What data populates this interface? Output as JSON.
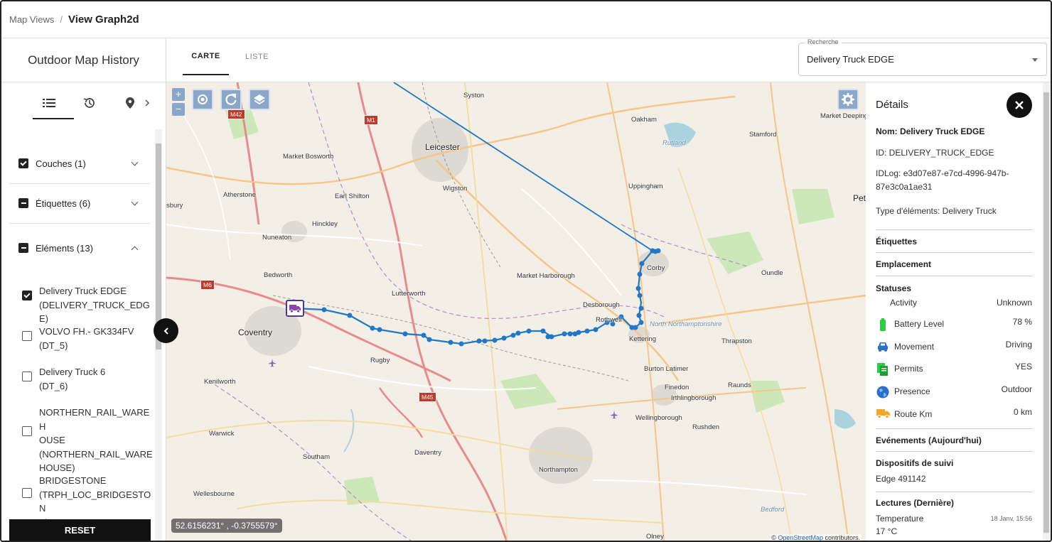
{
  "breadcrumb": {
    "parent": "Map Views",
    "separator": "/",
    "current": "View Graph2d"
  },
  "left_header": {
    "title": "Outdoor Map History"
  },
  "tabs": [
    {
      "label": "CARTE",
      "active": true
    },
    {
      "label": "LISTE",
      "active": false
    }
  ],
  "search": {
    "legend": "Recherche",
    "value": "Delivery Truck EDGE"
  },
  "sidebar": {
    "icons": [
      "list-icon",
      "history-icon",
      "location-pin-icon",
      "chevron-right-icon"
    ],
    "groups": [
      {
        "label": "Couches (1)",
        "state": "checked",
        "expanded": false
      },
      {
        "label": "Étiquettes (6)",
        "state": "partial",
        "expanded": false
      },
      {
        "label": "Eléments (13)",
        "state": "partial",
        "expanded": true
      }
    ],
    "elements": [
      {
        "lines": [
          "Delivery Truck EDGE",
          "(DELIVERY_TRUCK_EDGE)"
        ],
        "checked": true
      },
      {
        "lines": [
          "VOLVO FH.- GK334FV",
          "(DT_5)"
        ],
        "checked": false
      },
      {
        "lines": [
          "Delivery Truck 6",
          "(DT_6)"
        ],
        "checked": false
      },
      {
        "lines": [
          "NORTHERN_RAIL_WAREH",
          "OUSE",
          "(NORTHERN_RAIL_WARE",
          "HOUSE)"
        ],
        "checked": false
      },
      {
        "lines": [
          "BRIDGESTONE",
          "(TRPH_LOC_BRIDGESTON",
          "E)"
        ],
        "checked": false
      }
    ],
    "reset_label": "RESET"
  },
  "map": {
    "coordinates": "52.6156231° , -0.3755579°",
    "attribution_prefix": "© ",
    "attribution_link": "OpenStreetMap",
    "attribution_suffix": " contributors.",
    "zoom_in": "+",
    "zoom_out": "−",
    "places": [
      {
        "name": "Syston"
      },
      {
        "name": "Oakham"
      },
      {
        "name": "Leicester"
      },
      {
        "name": "Market Bosworth"
      },
      {
        "name": "Stamford"
      },
      {
        "name": "Rutland"
      },
      {
        "name": "Market Deeping"
      },
      {
        "name": "Earl Shilton"
      },
      {
        "name": "Wigston"
      },
      {
        "name": "Uppingham"
      },
      {
        "name": "Atherstone"
      },
      {
        "name": "Hinckley"
      },
      {
        "name": "Nuneaton"
      },
      {
        "name": "Corby"
      },
      {
        "name": "Bedworth"
      },
      {
        "name": "Market Harborough"
      },
      {
        "name": "Oundle"
      },
      {
        "name": "Lutterworth"
      },
      {
        "name": "Desborough"
      },
      {
        "name": "Rothwell"
      },
      {
        "name": "Coventry"
      },
      {
        "name": "North Northamptonshire"
      },
      {
        "name": "Kettering"
      },
      {
        "name": "Thrapston"
      },
      {
        "name": "Rugby"
      },
      {
        "name": "Kenilworth"
      },
      {
        "name": "Burton Latimer"
      },
      {
        "name": "Finedon"
      },
      {
        "name": "Raunds"
      },
      {
        "name": "Irthlingborough"
      },
      {
        "name": "Wellingborough"
      },
      {
        "name": "Rushden"
      },
      {
        "name": "Warwick"
      },
      {
        "name": "Southam"
      },
      {
        "name": "Daventry"
      },
      {
        "name": "Northampton"
      },
      {
        "name": "Wellesbourne"
      },
      {
        "name": "Bedford"
      },
      {
        "name": "Olney"
      },
      {
        "name": "sbury"
      },
      {
        "name": "Pet"
      }
    ],
    "road_shields": [
      "M42",
      "M1",
      "M6",
      "M45"
    ]
  },
  "details": {
    "title": "Détails",
    "name_label": "Nom: Delivery Truck EDGE",
    "id_line": "ID: DELIVERY_TRUCK_EDGE",
    "idlog_line1": "IDLog: e3d07e87-e7cd-4996-947b-",
    "idlog_line2": "87e3c0a1ae31",
    "type_line": "Type d'éléments: Delivery Truck",
    "sections": {
      "labels": "Étiquettes",
      "location": "Emplacement",
      "statuses": "Statuses",
      "events": "Evénements (Aujourd'hui)",
      "trackers": "Dispositifs de suivi",
      "readings": "Lectures (Dernière)"
    },
    "statuses": [
      {
        "label": "Activity",
        "value": "Unknown",
        "icon": "none"
      },
      {
        "label": "Battery Level",
        "value": "78 %",
        "icon": "battery-icon"
      },
      {
        "label": "Movement",
        "value": "Driving",
        "icon": "car-icon"
      },
      {
        "label": "Permits",
        "value": "YES",
        "icon": "documents-icon"
      },
      {
        "label": "Presence",
        "value": "Outdoor",
        "icon": "globe-icon"
      },
      {
        "label": "Route Km",
        "value": "0 km",
        "icon": "truck-icon"
      }
    ],
    "tracker": "Edge 491142",
    "reading": {
      "label": "Temperature",
      "value": "17 °C",
      "time": "18 Janv, 15:56"
    }
  },
  "colors": {
    "route": "#1f78c8",
    "route_dots": "#1f78c8",
    "accent_dark": "#111111",
    "battery_green": "#2ecc40",
    "truck_orange": "#f5a623",
    "map_control": "#8aa6c9"
  }
}
